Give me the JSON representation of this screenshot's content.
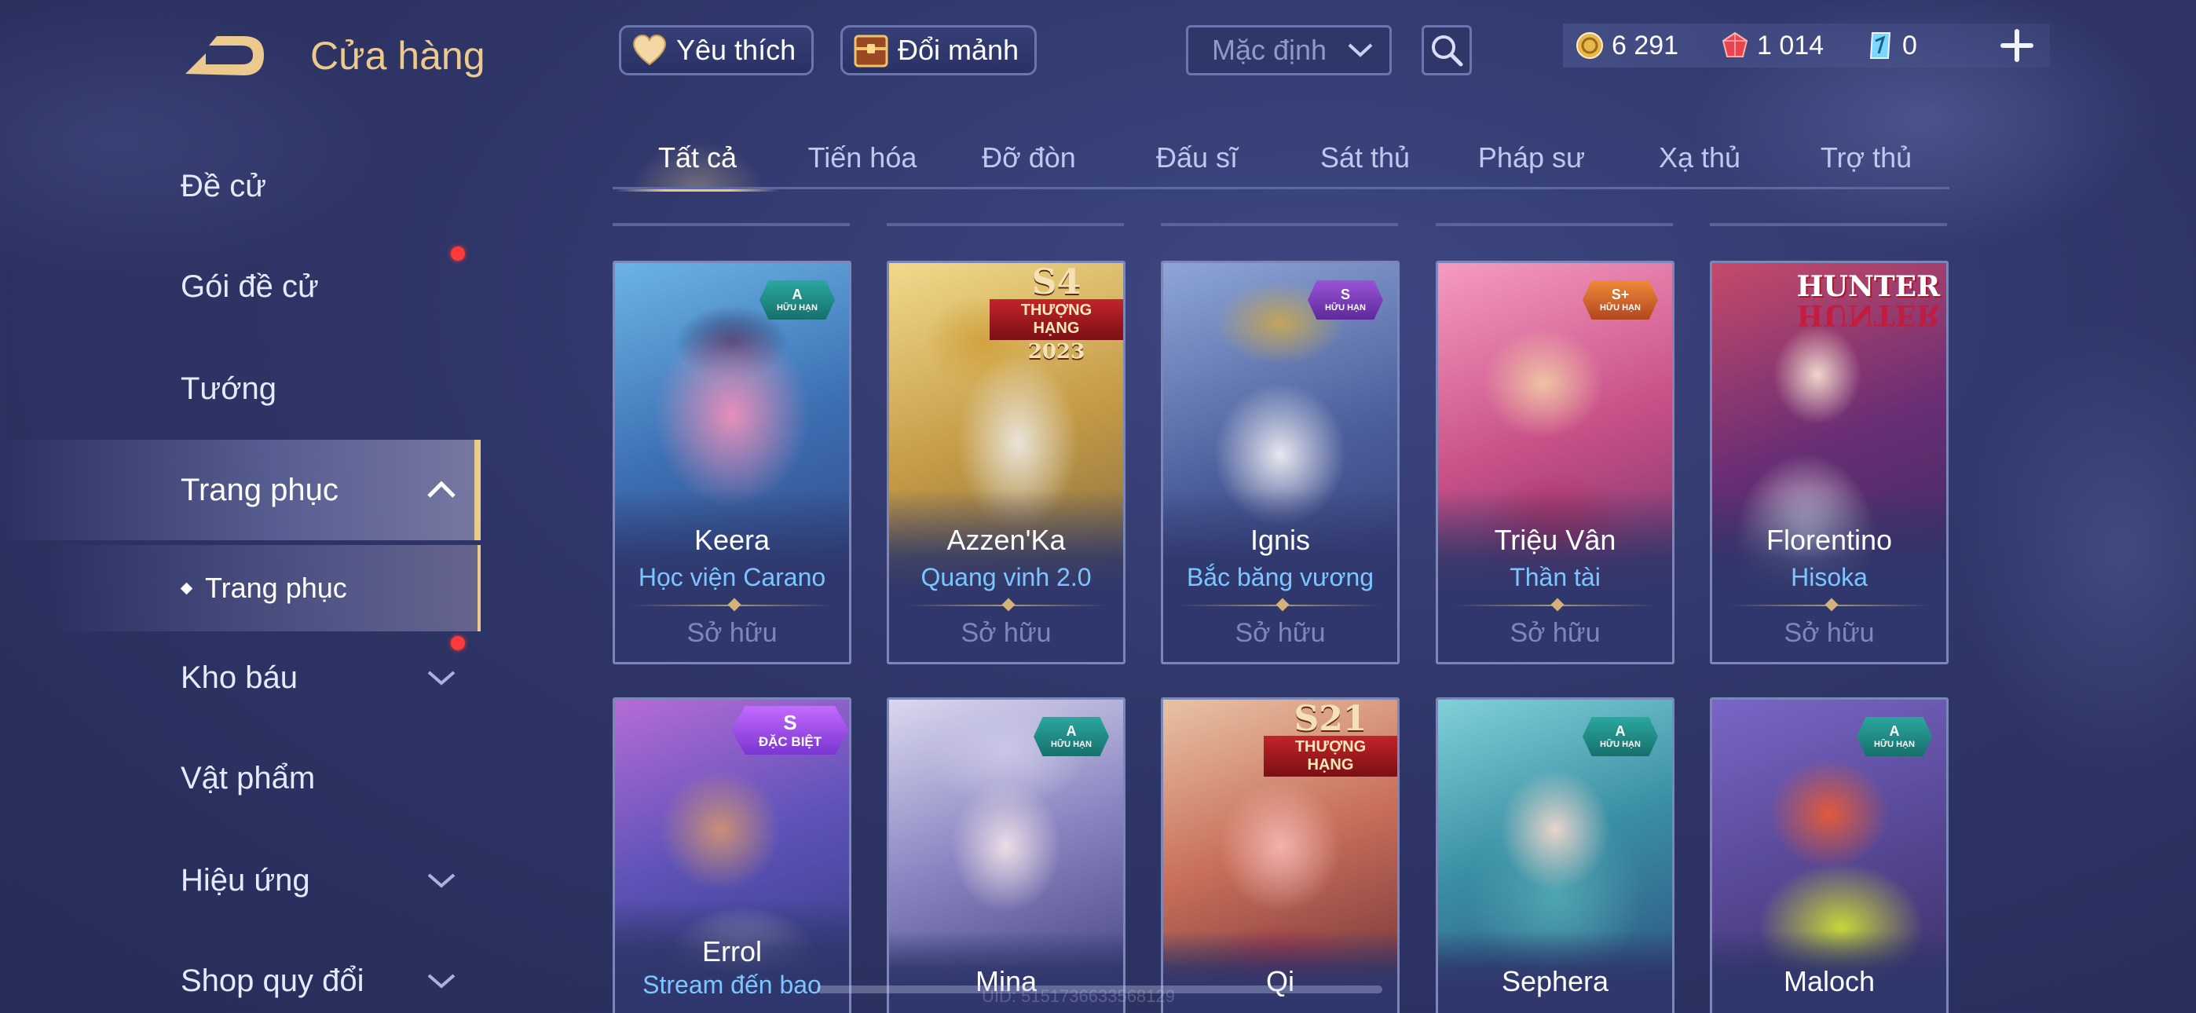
{
  "header": {
    "title": "Cửa hàng",
    "favorites_label": "Yêu thích",
    "exchange_label": "Đổi mảnh",
    "sort_value": "Mặc định",
    "currency": {
      "gold": "6 291",
      "ruby": "1 014",
      "voucher": "0"
    }
  },
  "sidebar": {
    "items": [
      {
        "label": "Đề cử"
      },
      {
        "label": "Gói đề cử"
      },
      {
        "label": "Tướng"
      },
      {
        "label": "Trang phục"
      },
      {
        "label": "Trang phục"
      },
      {
        "label": "Kho báu"
      },
      {
        "label": "Vật phẩm"
      },
      {
        "label": "Hiệu ứng"
      },
      {
        "label": "Shop quy đổi"
      }
    ]
  },
  "tabs": [
    "Tất cả",
    "Tiến hóa",
    "Đỡ đòn",
    "Đấu sĩ",
    "Sát thủ",
    "Pháp sư",
    "Xạ thủ",
    "Trợ thủ"
  ],
  "cards": [
    {
      "hero": "Keera",
      "skin": "Học viện Carano",
      "status": "Sở hữu",
      "badge": {
        "grade": "A",
        "sub": "HỮU HẠN"
      }
    },
    {
      "hero": "Azzen'Ka",
      "skin": "Quang vinh 2.0",
      "status": "Sở hữu",
      "ranked": {
        "season": "S4",
        "label": "THƯỢNG HẠNG",
        "year": "2023"
      }
    },
    {
      "hero": "Ignis",
      "skin": "Bắc băng vương",
      "status": "Sở hữu",
      "badge": {
        "grade": "S",
        "sub": "HỮU HẠN"
      }
    },
    {
      "hero": "Triệu Vân",
      "skin": "Thần tài",
      "status": "Sở hữu",
      "badge": {
        "grade": "S+",
        "sub": "HỮU HẠN"
      }
    },
    {
      "hero": "Florentino",
      "skin": "Hisoka",
      "status": "Sở hữu",
      "logo": "HUNTER"
    },
    {
      "hero": "Errol",
      "skin": "Stream đến bao",
      "badge": {
        "grade": "S",
        "sub": "ĐẶC BIỆT"
      }
    },
    {
      "hero": "Mina",
      "badge": {
        "grade": "A",
        "sub": "HỮU HẠN"
      }
    },
    {
      "hero": "Qi",
      "ranked": {
        "season": "S21",
        "label": "THƯỢNG HẠNG"
      }
    },
    {
      "hero": "Sephera",
      "badge": {
        "grade": "A",
        "sub": "HỮU HẠN"
      }
    },
    {
      "hero": "Maloch",
      "badge": {
        "grade": "A",
        "sub": "HỮU HẠN"
      }
    }
  ],
  "footer": {
    "uid": "UID: 5151736633568129"
  },
  "colors": {
    "accent_gold": "#e9c882",
    "skin_name": "#7cc6ff",
    "owned": "#7f88b6",
    "background": "#2f3668",
    "notification": "#ff3a3a"
  },
  "icons": [
    "back-arrow-icon",
    "heart-icon",
    "chest-icon",
    "chevron-down-icon",
    "search-icon",
    "gold-coin-icon",
    "ruby-icon",
    "voucher-icon",
    "plus-icon",
    "chevron-up-icon"
  ]
}
